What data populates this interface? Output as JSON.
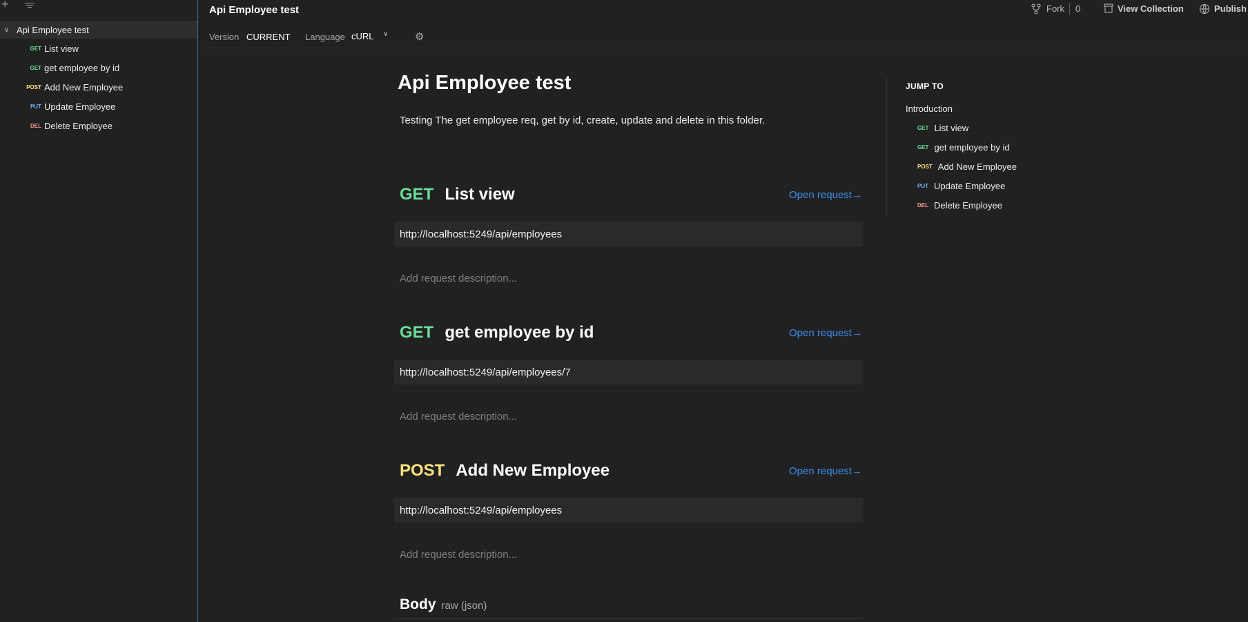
{
  "sidebar": {
    "collection_name": "Api Employee test",
    "items": [
      {
        "method": "GET",
        "label": "List view"
      },
      {
        "method": "GET",
        "label": "get employee by id"
      },
      {
        "method": "POST",
        "label": "Add New Employee"
      },
      {
        "method": "PUT",
        "label": "Update Employee"
      },
      {
        "method": "DEL",
        "label": "Delete Employee"
      }
    ]
  },
  "topbar": {
    "title": "Api Employee test",
    "version_label": "Version",
    "version_value": "CURRENT",
    "language_label": "Language",
    "language_value": "cURL",
    "fork_label": "Fork",
    "fork_count": "0",
    "view_collection_label": "View Collection",
    "publish_label": "Publish"
  },
  "doc": {
    "title": "Api Employee test",
    "description": "Testing The get employee req, get by id, create, update and delete in this folder.",
    "open_request_label": "Open request",
    "description_placeholder": "Add request description...",
    "requests": [
      {
        "method": "GET",
        "name": "List view",
        "url": "http://localhost:5249/api/employees"
      },
      {
        "method": "GET",
        "name": "get employee by id",
        "url": "http://localhost:5249/api/employees/7"
      },
      {
        "method": "POST",
        "name": "Add New Employee",
        "url": "http://localhost:5249/api/employees"
      }
    ],
    "body_label": "Body",
    "body_type": "raw (json)"
  },
  "jump_to": {
    "title": "JUMP TO",
    "intro": "Introduction",
    "items": [
      {
        "method": "GET",
        "label": "List view"
      },
      {
        "method": "GET",
        "label": "get employee by id"
      },
      {
        "method": "POST",
        "label": "Add New Employee"
      },
      {
        "method": "PUT",
        "label": "Update Employee"
      },
      {
        "method": "DEL",
        "label": "Delete Employee"
      }
    ]
  },
  "colors": {
    "get": "#6bdd9a",
    "post": "#ffe47e",
    "put": "#74aef6",
    "del": "#f79a8e",
    "link": "#3d8ef0",
    "background": "#212121"
  },
  "icons": [
    "plus-icon",
    "filter-icon",
    "chevron-down-icon",
    "gear-icon",
    "fork-icon",
    "view-collection-icon",
    "publish-icon",
    "arrow-right-icon"
  ]
}
